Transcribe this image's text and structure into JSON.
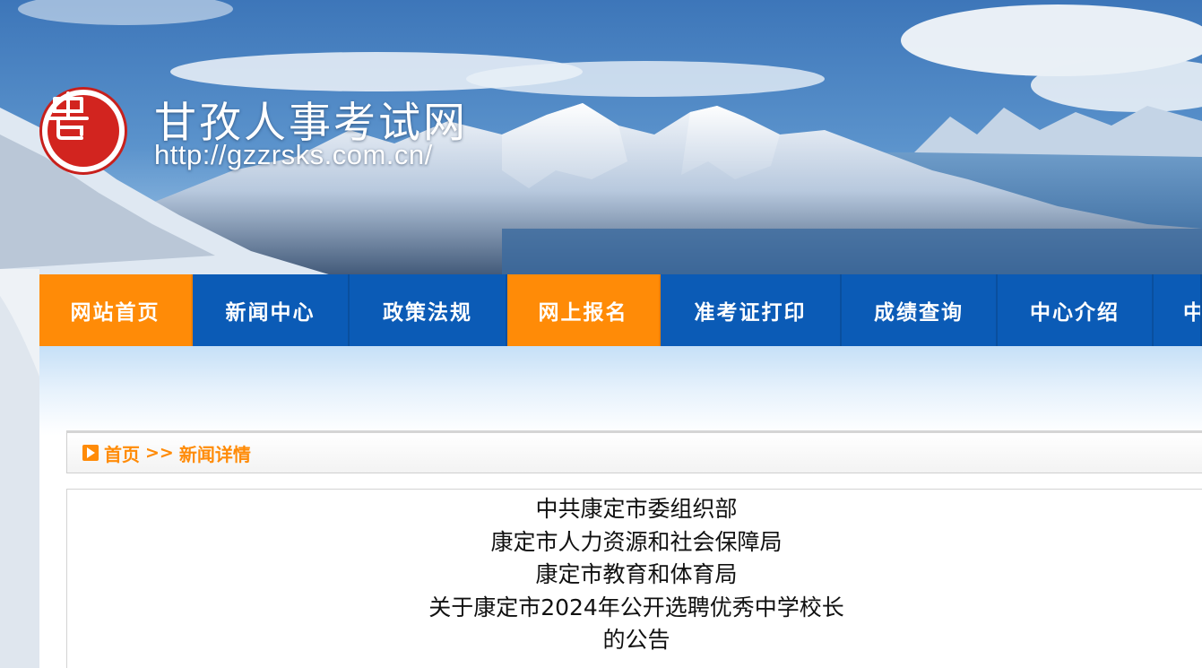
{
  "site": {
    "title": "甘孜人事考试网",
    "url": "http://gzzrsks.com.cn/"
  },
  "icons": {
    "logo": "seal-logo-icon",
    "breadcrumb": "play-arrow-icon"
  },
  "colors": {
    "nav_blue": "#0b5bb6",
    "nav_active": "#ff8b07",
    "breadcrumb_text": "#ff8b07",
    "logo_red": "#d2241f"
  },
  "nav": {
    "items": [
      {
        "label": "网站首页",
        "active": true
      },
      {
        "label": "新闻中心",
        "active": false
      },
      {
        "label": "政策法规",
        "active": false
      },
      {
        "label": "网上报名",
        "active": true
      },
      {
        "label": "准考证打印",
        "active": false
      },
      {
        "label": "成绩查询",
        "active": false
      },
      {
        "label": "中心介绍",
        "active": false
      },
      {
        "label": "中",
        "active": false
      }
    ]
  },
  "breadcrumb": {
    "home": "首页",
    "separator": ">>",
    "current": "新闻详情"
  },
  "article": {
    "title_lines": [
      "中共康定市委组织部",
      "康定市人力资源和社会保障局",
      "康定市教育和体育局",
      "关于康定市2024年公开选聘优秀中学校长",
      "的公告"
    ]
  }
}
